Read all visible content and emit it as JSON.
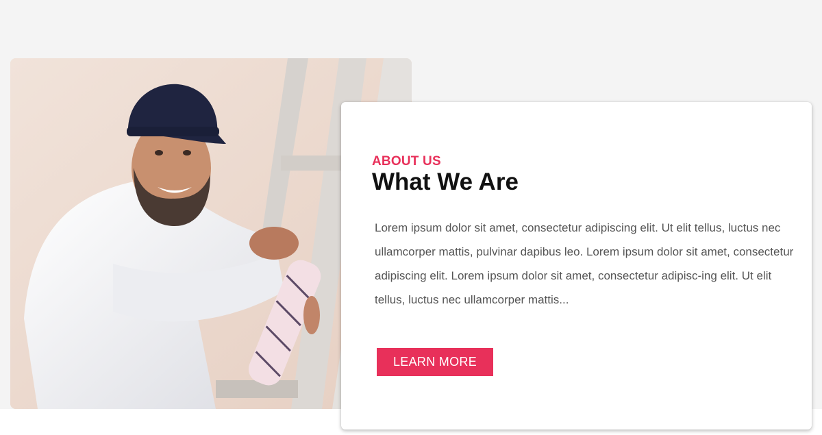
{
  "about": {
    "eyebrow": "ABOUT US",
    "title": "What We Are",
    "body": "Lorem ipsum dolor sit amet, consectetur adipiscing elit. Ut elit tellus, luctus nec ullamcorper mattis, pulvinar dapibus leo. Lorem ipsum dolor sit amet, consectetur adipiscing elit. Lorem ipsum dolor sit amet, consectetur adipisc-ing elit. Ut elit tellus, luctus nec ullamcorper mattis...",
    "button_label": "LEARN MORE"
  },
  "colors": {
    "accent": "#e8305a",
    "page_background": "#f4f4f4",
    "card_background": "#ffffff",
    "heading": "#111111",
    "body_text": "#555555"
  },
  "image": {
    "subject": "smiling painter in cap and white shirt holding a paint roller beside a ladder"
  }
}
